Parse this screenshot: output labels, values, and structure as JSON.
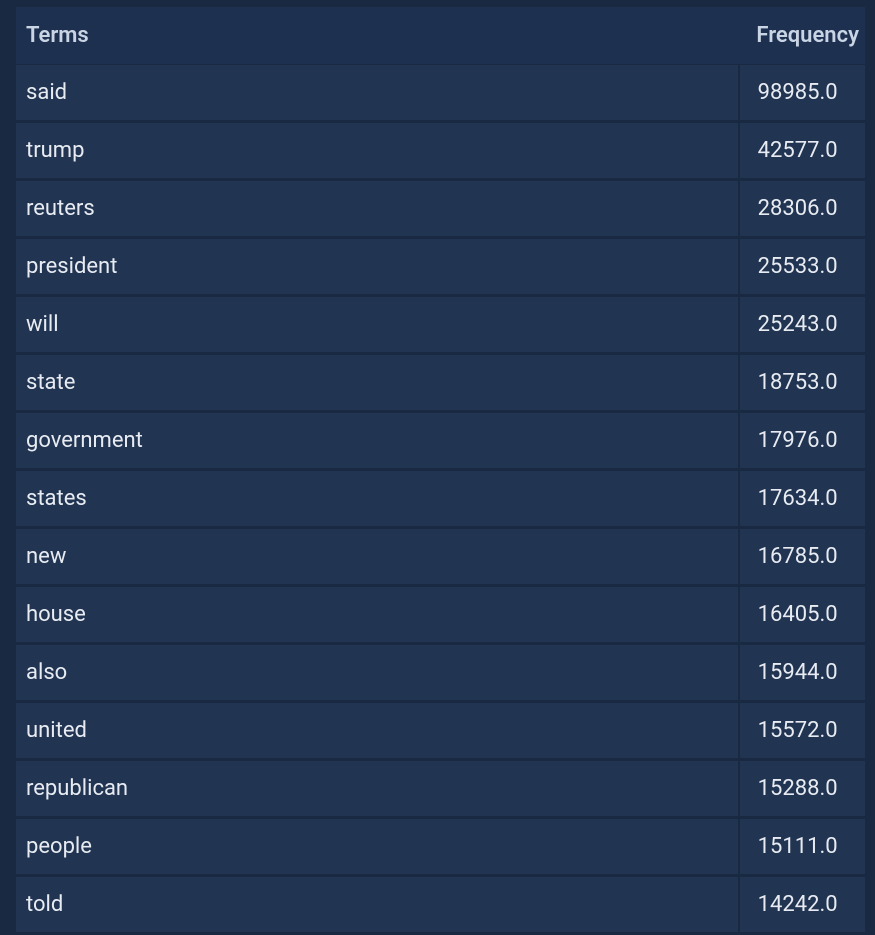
{
  "table": {
    "headers": {
      "terms": "Terms",
      "frequency": "Frequency"
    },
    "rows": [
      {
        "term": "said",
        "frequency": "98985.0"
      },
      {
        "term": "trump",
        "frequency": "42577.0"
      },
      {
        "term": "reuters",
        "frequency": "28306.0"
      },
      {
        "term": "president",
        "frequency": "25533.0"
      },
      {
        "term": "will",
        "frequency": "25243.0"
      },
      {
        "term": "state",
        "frequency": "18753.0"
      },
      {
        "term": "government",
        "frequency": "17976.0"
      },
      {
        "term": "states",
        "frequency": "17634.0"
      },
      {
        "term": "new",
        "frequency": "16785.0"
      },
      {
        "term": "house",
        "frequency": "16405.0"
      },
      {
        "term": "also",
        "frequency": "15944.0"
      },
      {
        "term": "united",
        "frequency": "15572.0"
      },
      {
        "term": "republican",
        "frequency": "15288.0"
      },
      {
        "term": "people",
        "frequency": "15111.0"
      },
      {
        "term": "told",
        "frequency": "14242.0"
      }
    ]
  }
}
